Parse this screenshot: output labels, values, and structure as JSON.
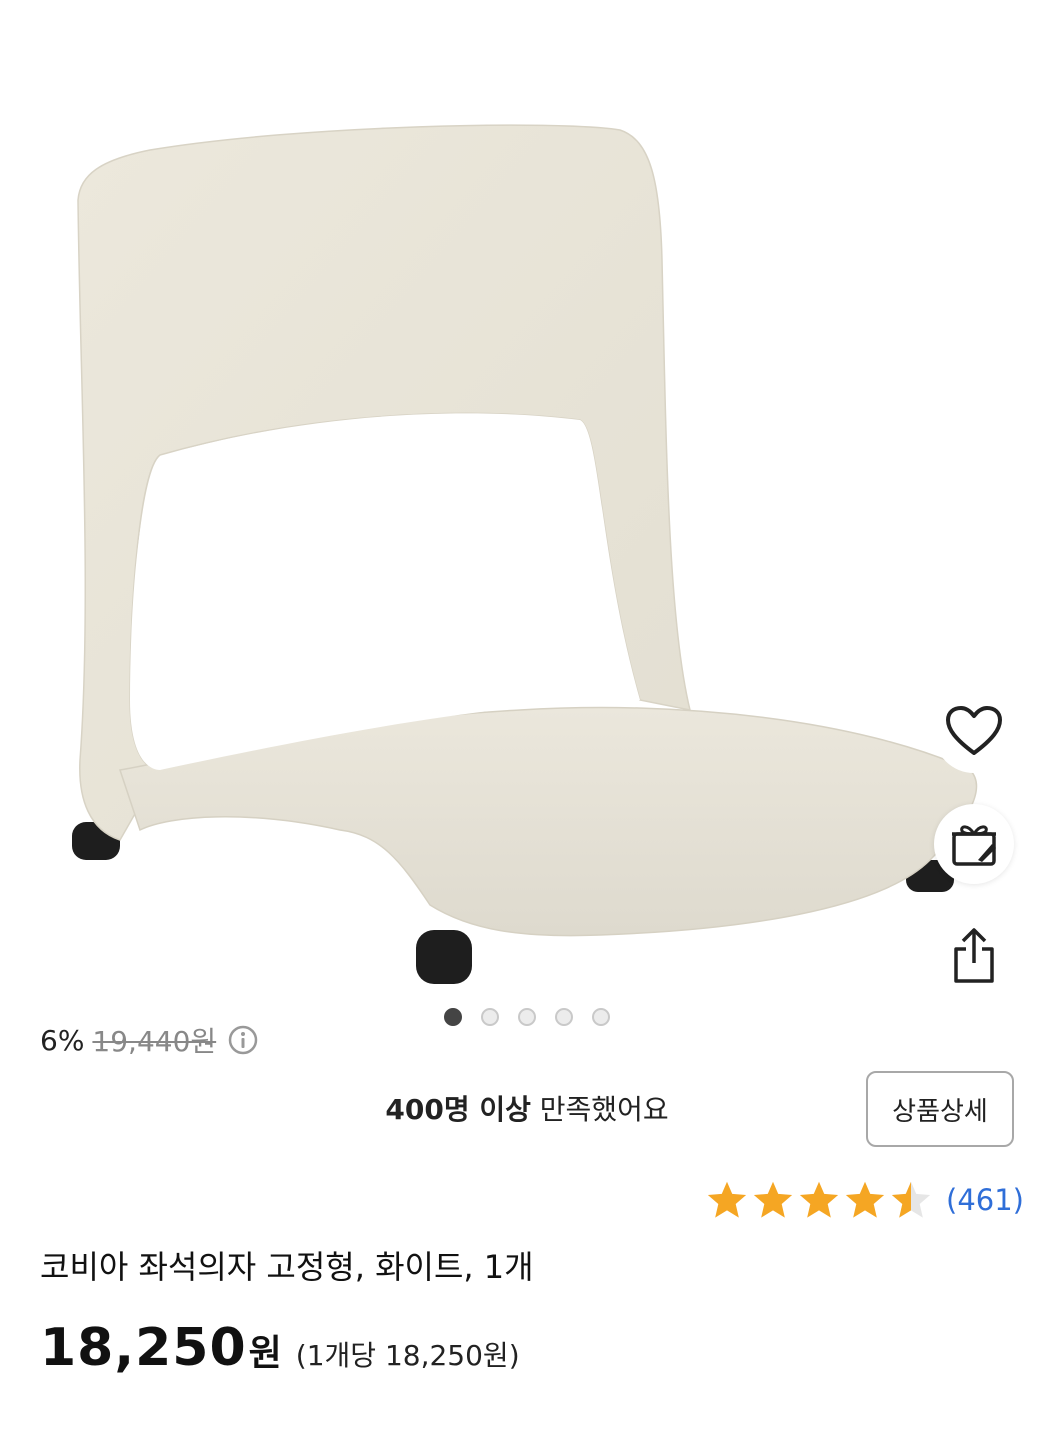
{
  "product_image": {
    "alt": "코비아 좌석의자 고정형 화이트",
    "carousel": {
      "total": 5,
      "active_index": 0
    }
  },
  "side_actions": {
    "wishlist_icon": "heart-icon",
    "gift_icon": "gift-icon",
    "share_icon": "share-icon"
  },
  "satisfaction": {
    "bold": "400명 이상",
    "rest": " 만족했어요"
  },
  "detail_button": {
    "label": "상품상세"
  },
  "rating": {
    "value": 4.5,
    "max": 5,
    "count_text": "(461)"
  },
  "product": {
    "title": "코비아 좌석의자 고정형, 화이트, 1개"
  },
  "pricing": {
    "discount_pct": "6%",
    "original_price": "19,440원",
    "final_price": "18,250",
    "final_unit": "원",
    "unit_price": "(1개당 18,250원)"
  },
  "colors": {
    "star": "#F5A623",
    "review_link": "#2F6ED8",
    "text": "#111111"
  }
}
